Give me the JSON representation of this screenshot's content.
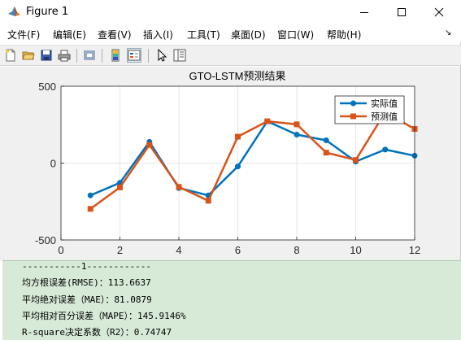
{
  "window": {
    "title": "Figure 1",
    "controls": {
      "minimize": "minimize",
      "maximize": "maximize",
      "close": "close"
    }
  },
  "menubar": {
    "items": [
      {
        "label": "文件(F)"
      },
      {
        "label": "编辑(E)"
      },
      {
        "label": "查看(V)"
      },
      {
        "label": "插入(I)"
      },
      {
        "label": "工具(T)"
      },
      {
        "label": "桌面(D)"
      },
      {
        "label": "窗口(W)"
      },
      {
        "label": "帮助(H)"
      }
    ],
    "overflow_arrow": "↘"
  },
  "toolbar": {
    "buttons": [
      "new-figure-icon",
      "open-file-icon",
      "save-icon",
      "print-icon",
      "link-plot-icon",
      "colorbar-icon",
      "legend-icon",
      "edit-plot-cursor-icon",
      "property-inspector-icon"
    ]
  },
  "chart_data": {
    "type": "line",
    "title": "GTO-LSTM预测结果",
    "xlabel": "",
    "ylabel": "",
    "xlim": [
      0,
      12
    ],
    "ylim": [
      -500,
      500
    ],
    "x_ticks": [
      "0",
      "2",
      "4",
      "6",
      "8",
      "10",
      "12"
    ],
    "y_ticks": [
      "-500",
      "0",
      "500"
    ],
    "grid": true,
    "legend_position": "top-right",
    "x": [
      1,
      2,
      3,
      4,
      5,
      6,
      7,
      8,
      9,
      10,
      11,
      12
    ],
    "series": [
      {
        "name": "实际值",
        "color": "#0072bd",
        "marker": "circle",
        "values": [
          -210,
          -128,
          138,
          -162,
          -210,
          -22,
          272,
          185,
          148,
          10,
          88,
          48
        ]
      },
      {
        "name": "预测值",
        "color": "#d95319",
        "marker": "square",
        "values": [
          -298,
          -158,
          118,
          -155,
          -245,
          172,
          272,
          252,
          68,
          20,
          330,
          222
        ]
      }
    ]
  },
  "console": {
    "lines": [
      "-----------1------------",
      "均方根误差(RMSE)：113.6637",
      "平均绝对误差（MAE）：81.0879",
      "平均相对百分误差（MAPE）：145.9146%",
      "R-square决定系数（R2）：0.74747"
    ]
  }
}
